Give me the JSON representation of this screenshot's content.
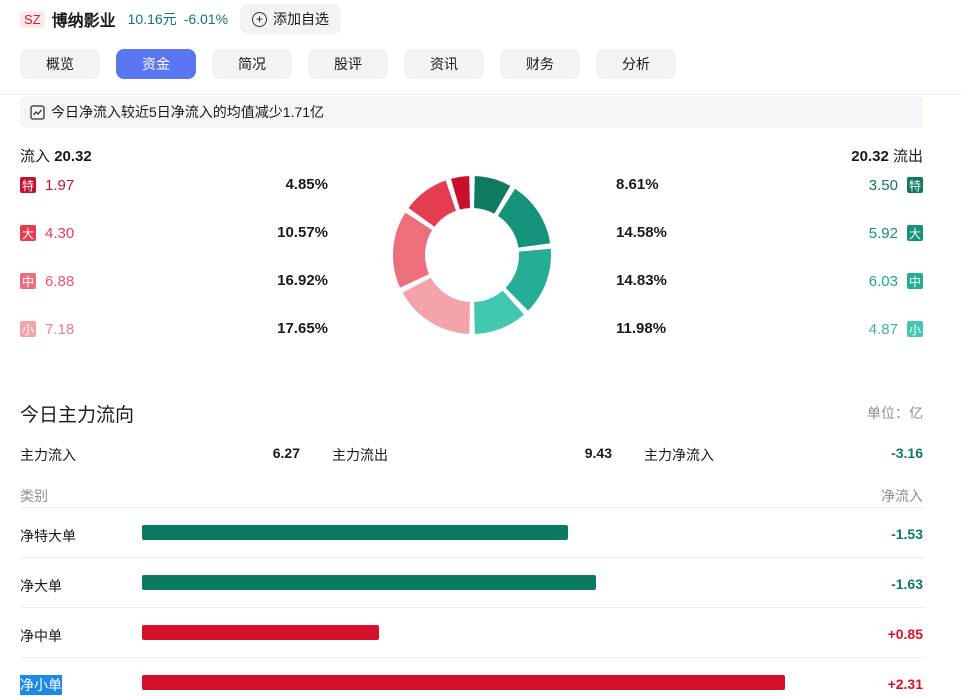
{
  "stock": {
    "market": "SZ",
    "name": "博纳影业",
    "price": "10.16元",
    "change": "-6.01%",
    "add_label": "添加自选"
  },
  "tabs": [
    "概览",
    "资金",
    "简况",
    "股评",
    "资讯",
    "财务",
    "分析"
  ],
  "active_tab": "资金",
  "banner": {
    "text": "今日净流入较近5日净流入的均值减少1.71亿"
  },
  "flow": {
    "inflow_label": "流入",
    "inflow_total": "20.32",
    "outflow_label": "流出",
    "outflow_total": "20.32",
    "inflow": [
      {
        "badge": "特",
        "value": "1.97",
        "pct": "4.85%",
        "color": "#c8102e"
      },
      {
        "badge": "大",
        "value": "4.30",
        "pct": "10.57%",
        "color": "#e33d4f"
      },
      {
        "badge": "中",
        "value": "6.88",
        "pct": "16.92%",
        "color": "#ee6f7c"
      },
      {
        "badge": "小",
        "value": "7.18",
        "pct": "17.65%",
        "color": "#f5a3ab"
      }
    ],
    "outflow": [
      {
        "badge": "特",
        "value": "3.50",
        "pct": "8.61%",
        "color": "#0e7a60"
      },
      {
        "badge": "大",
        "value": "5.92",
        "pct": "14.58%",
        "color": "#14927a"
      },
      {
        "badge": "中",
        "value": "6.03",
        "pct": "14.83%",
        "color": "#25ae95"
      },
      {
        "badge": "小",
        "value": "4.87",
        "pct": "11.98%",
        "color": "#44c7b0"
      }
    ]
  },
  "main": {
    "title": "今日主力流向",
    "unit": "单位：亿",
    "inflow_label": "主力流入",
    "inflow": "6.27",
    "outflow_label": "主力流出",
    "outflow": "9.43",
    "net_label": "主力净流入",
    "net": "-3.16",
    "col_category": "类别",
    "col_net": "净流入",
    "rows": [
      {
        "label": "净特大单",
        "value": "-1.53",
        "amount": -1.53
      },
      {
        "label": "净大单",
        "value": "-1.63",
        "amount": -1.63
      },
      {
        "label": "净中单",
        "value": "+0.85",
        "amount": 0.85
      },
      {
        "label": "净小单",
        "value": "+2.31",
        "amount": 2.31
      }
    ]
  },
  "colors": {
    "up": "#d6102b",
    "down": "#0b7a63",
    "accent": "#5a76f0"
  }
}
